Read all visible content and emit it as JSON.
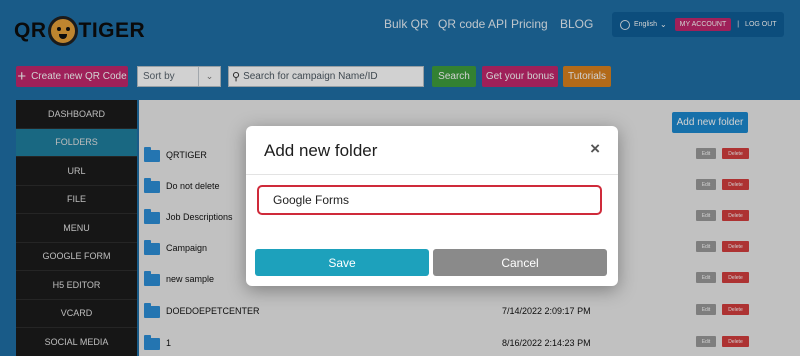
{
  "header": {
    "logo_left": "QR",
    "logo_right": "TIGER",
    "nav": [
      "Bulk QR",
      "QR code API",
      "Pricing",
      "BLOG"
    ],
    "language": "English",
    "my_account": "MY ACCOUNT",
    "separator": "|",
    "logout": "LOG OUT"
  },
  "toolbar": {
    "create_label": "Create new QR Code",
    "sort_placeholder": "Sort by",
    "search_placeholder": "Search for campaign Name/ID",
    "search_button": "Search",
    "bonus_button": "Get your bonus",
    "tutorials_button": "Tutorials"
  },
  "sidebar": {
    "items": [
      "DASHBOARD",
      "FOLDERS",
      "URL",
      "FILE",
      "MENU",
      "GOOGLE FORM",
      "H5 EDITOR",
      "VCARD",
      "SOCIAL MEDIA"
    ],
    "active": "FOLDERS"
  },
  "main": {
    "add_folder_label": "Add new folder",
    "edit_label": "Edit",
    "delete_label": "Delete",
    "folders": [
      {
        "name": "QRTIGER",
        "date": ""
      },
      {
        "name": "Do not delete",
        "date": ""
      },
      {
        "name": "Job Descriptions",
        "date": ""
      },
      {
        "name": "Campaign",
        "date": ""
      },
      {
        "name": "new sample",
        "date": ""
      },
      {
        "name": "DOEDOEPETCENTER",
        "date": "7/14/2022 2:09:17 PM"
      },
      {
        "name": "1",
        "date": "8/16/2022 2:14:23 PM"
      }
    ]
  },
  "modal": {
    "title": "Add new folder",
    "close": "×",
    "input_value": "Google Forms",
    "save": "Save",
    "cancel": "Cancel"
  },
  "colors": {
    "header_bg": "#1f6fa6",
    "brand_pink": "#c2286d",
    "save_blue": "#1da1bc",
    "input_focus_red": "#cf2a3a"
  }
}
